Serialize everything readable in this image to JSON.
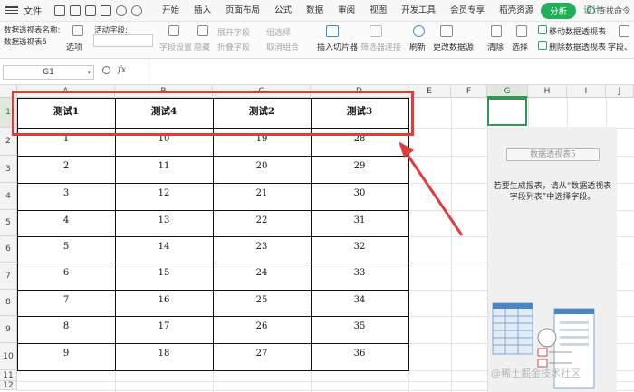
{
  "menubar": {
    "file": "文件",
    "menus": [
      "开始",
      "插入",
      "页面布局",
      "公式",
      "数据",
      "审阅",
      "视图",
      "开发工具",
      "会员专享",
      "稻壳资源"
    ],
    "analyze": "分析",
    "design": "设计",
    "search": "查找命令"
  },
  "ribbon": {
    "pt_name_label": "数据透视表名称:",
    "pt_name_value": "数据透视表5",
    "options": "选项",
    "active_field_label": "活动字段:",
    "field_settings": "字段设置",
    "hide": "隐藏",
    "expand_field": "展开字段",
    "collapse_field": "折叠字段",
    "group_selection": "组选择",
    "ungroup": "取消组合",
    "insert_slicer": "插入切片器",
    "filter_connections": "筛选器连接",
    "refresh": "刷新",
    "change_source": "更改数据源",
    "clear": "清除",
    "select": "选择",
    "move_pt": "移动数据透视表",
    "delete_pt": "删除数据透视表",
    "field_list": "字段、"
  },
  "formula_bar": {
    "name_box": "G1",
    "fx": "fx"
  },
  "columns": [
    "A",
    "B",
    "C",
    "D",
    "E",
    "F",
    "G",
    "H",
    "I",
    "J"
  ],
  "rows": [
    "1",
    "2",
    "3",
    "4",
    "5",
    "6",
    "7",
    "8",
    "9",
    "10",
    "11",
    "12"
  ],
  "table": {
    "headers": [
      "测试1",
      "测试4",
      "测试2",
      "测试3"
    ],
    "rows": [
      [
        "1",
        "10",
        "19",
        "28"
      ],
      [
        "2",
        "11",
        "20",
        "29"
      ],
      [
        "3",
        "12",
        "21",
        "30"
      ],
      [
        "4",
        "13",
        "22",
        "31"
      ],
      [
        "5",
        "14",
        "23",
        "32"
      ],
      [
        "6",
        "15",
        "24",
        "33"
      ],
      [
        "7",
        "16",
        "25",
        "34"
      ],
      [
        "8",
        "17",
        "26",
        "35"
      ],
      [
        "9",
        "18",
        "27",
        "36"
      ]
    ]
  },
  "pivot_panel": {
    "title": "数据透视表5",
    "message": "若要生成报表，请从“数据透视表字段列表”中选择字段。"
  },
  "watermark": "@稀土掘金技术社区",
  "colors": {
    "accent_green": "#1fb15a",
    "annotation_red": "#e23b3b"
  }
}
